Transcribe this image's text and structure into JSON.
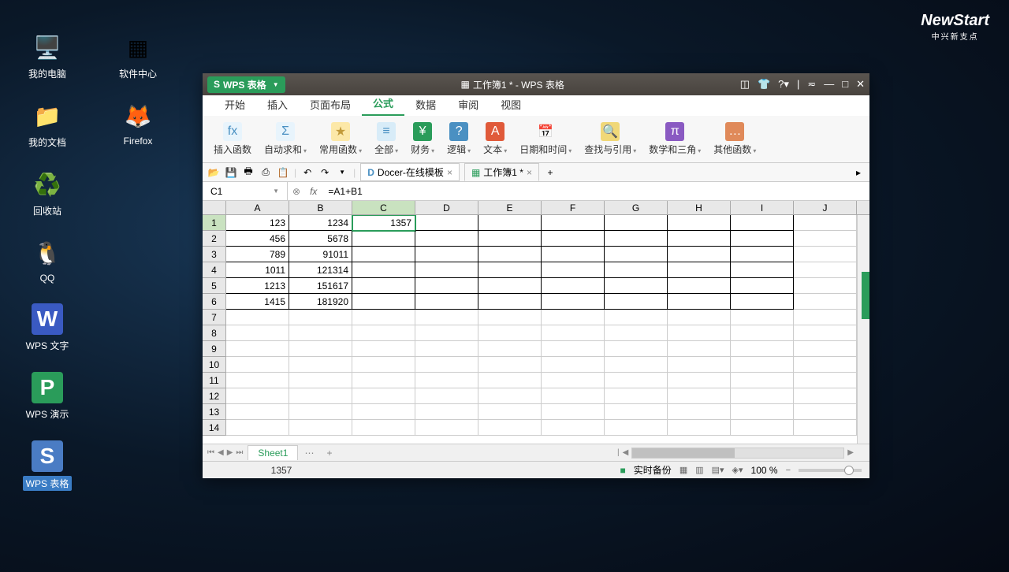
{
  "brand": {
    "logo": "NewStart",
    "sub": "中兴新支点"
  },
  "desktop": {
    "icons_col1": [
      {
        "key": "my-computer",
        "label": "我的电脑",
        "glyph": "🖥️"
      },
      {
        "key": "my-docs",
        "label": "我的文档",
        "glyph": "📁"
      },
      {
        "key": "trash",
        "label": "回收站",
        "glyph": "♻️"
      },
      {
        "key": "qq",
        "label": "QQ",
        "glyph": "🐧"
      },
      {
        "key": "wps-writer",
        "label": "WPS 文字",
        "glyph": "W"
      },
      {
        "key": "wps-present",
        "label": "WPS 演示",
        "glyph": "P"
      },
      {
        "key": "wps-sheet",
        "label": "WPS 表格",
        "glyph": "S",
        "selected": true
      }
    ],
    "icons_col2": [
      {
        "key": "software-center",
        "label": "软件中心",
        "glyph": "▦"
      },
      {
        "key": "firefox",
        "label": "Firefox",
        "glyph": "🦊"
      }
    ]
  },
  "titlebar": {
    "app_label": "WPS 表格",
    "doc_title": "工作簿1 * - WPS 表格"
  },
  "ribbon_tabs": [
    {
      "label": "开始",
      "active": false
    },
    {
      "label": "插入",
      "active": false
    },
    {
      "label": "页面布局",
      "active": false
    },
    {
      "label": "公式",
      "active": true
    },
    {
      "label": "数据",
      "active": false
    },
    {
      "label": "审阅",
      "active": false
    },
    {
      "label": "视图",
      "active": false
    }
  ],
  "toolbar": [
    {
      "label": "插入函数",
      "icon": "fx",
      "bg": "#e8f4fc",
      "color": "#4a90c2",
      "dd": false
    },
    {
      "label": "自动求和",
      "icon": "Σ",
      "bg": "#e8f4fc",
      "color": "#4a90c2",
      "dd": true
    },
    {
      "label": "常用函数",
      "icon": "★",
      "bg": "#fce8a8",
      "color": "#c29a3a",
      "dd": true
    },
    {
      "label": "全部",
      "icon": "≡",
      "bg": "#d8ecf8",
      "color": "#4a90c2",
      "dd": true
    },
    {
      "label": "财务",
      "icon": "¥",
      "bg": "#2a9c5a",
      "color": "#fff",
      "dd": true
    },
    {
      "label": "逻辑",
      "icon": "?",
      "bg": "#4a90c2",
      "color": "#fff",
      "dd": true
    },
    {
      "label": "文本",
      "icon": "A",
      "bg": "#e05a3a",
      "color": "#fff",
      "dd": true
    },
    {
      "label": "日期和时间",
      "icon": "📅",
      "bg": "",
      "color": "#c2743a",
      "dd": true
    },
    {
      "label": "查找与引用",
      "icon": "🔍",
      "bg": "#f0d878",
      "color": "#8a6a2a",
      "dd": true
    },
    {
      "label": "数学和三角",
      "icon": "π",
      "bg": "#8a5ac2",
      "color": "#fff",
      "dd": true
    },
    {
      "label": "其他函数",
      "icon": "…",
      "bg": "#e08a5a",
      "color": "#fff",
      "dd": true
    }
  ],
  "doc_tabs": {
    "docer": "Docer-在线模板",
    "workbook": "工作簿1 *"
  },
  "formula": {
    "cell_ref": "C1",
    "value": "=A1+B1"
  },
  "columns": [
    "A",
    "B",
    "C",
    "D",
    "E",
    "F",
    "G",
    "H",
    "I",
    "J"
  ],
  "rows": [
    1,
    2,
    3,
    4,
    5,
    6,
    7,
    8,
    9,
    10,
    11,
    12,
    13,
    14
  ],
  "active_cell": {
    "row": 1,
    "col": "C"
  },
  "cells": {
    "A1": "123",
    "B1": "1234",
    "C1": "1357",
    "A2": "456",
    "B2": "5678",
    "A3": "789",
    "B3": "91011",
    "A4": "1011",
    "B4": "121314",
    "A5": "1213",
    "B5": "151617",
    "A6": "1415",
    "B6": "181920"
  },
  "sheets": {
    "current": "Sheet1"
  },
  "status": {
    "value": "1357",
    "backup": "实时备份",
    "zoom": "100 %"
  }
}
